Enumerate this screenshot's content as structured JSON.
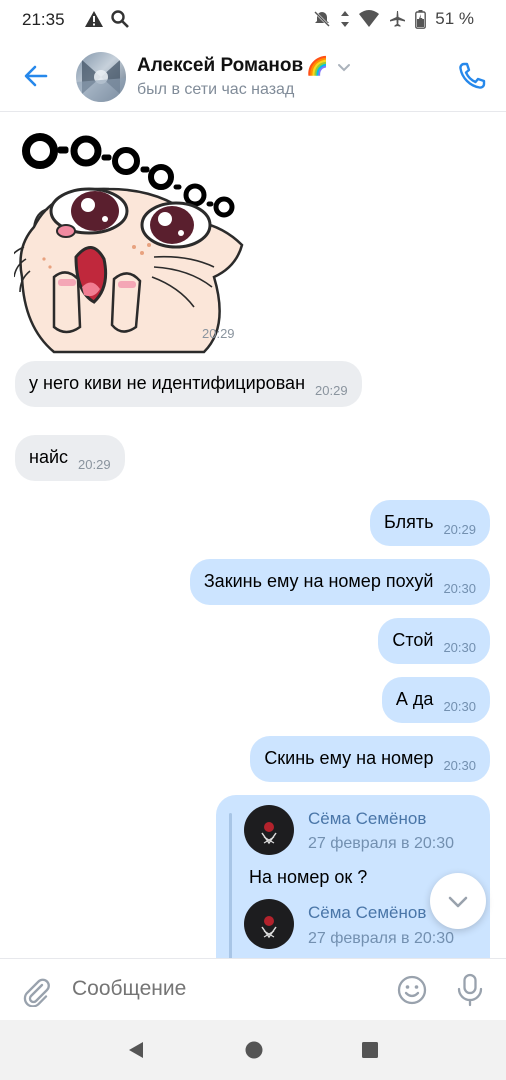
{
  "status_bar": {
    "time": "21:35",
    "battery": "51 %"
  },
  "header": {
    "name": "Алексей Романов",
    "emoji": "🌈",
    "status": "был в сети час назад"
  },
  "sticker": {
    "text": "O-O-o-o-o",
    "time": "20:29"
  },
  "messages": [
    {
      "text": "у него киви не идентифицирован",
      "time": "20:29",
      "dir": "in"
    },
    {
      "text": "найс",
      "time": "20:29",
      "dir": "in"
    },
    {
      "text": "Блять",
      "time": "20:29",
      "dir": "out"
    },
    {
      "text": "Закинь ему на номер похуй",
      "time": "20:30",
      "dir": "out"
    },
    {
      "text": "Стой",
      "time": "20:30",
      "dir": "out"
    },
    {
      "text": "А да",
      "time": "20:30",
      "dir": "out"
    },
    {
      "text": "Скинь ему на номер",
      "time": "20:30",
      "dir": "out"
    }
  ],
  "forwarded": [
    {
      "author": "Сёма Семёнов",
      "date": "27 февраля в 20:30",
      "text": "На номер ок ?"
    },
    {
      "author": "Сёма Семёнов",
      "date": "27 февраля в 20:30"
    }
  ],
  "composer": {
    "placeholder": "Сообщение"
  },
  "colors": {
    "accent": "#2688eb",
    "out_bubble": "#cce4ff",
    "in_bubble": "#ebedf0"
  }
}
